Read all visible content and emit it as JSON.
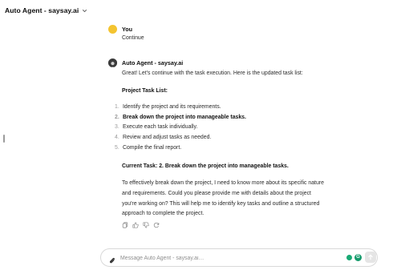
{
  "header": {
    "title": "Auto Agent - saysay.ai"
  },
  "conversation": {
    "user_message": {
      "author": "You",
      "text": "Continue"
    },
    "agent_message": {
      "author": "Auto Agent - saysay.ai",
      "intro": "Great! Let's continue with the task execution. Here is the updated task list:",
      "task_list_heading": "Project Task List:",
      "tasks": [
        {
          "num": "1.",
          "text": "Identify the project and its requirements."
        },
        {
          "num": "2.",
          "text": "Break down the project into manageable tasks."
        },
        {
          "num": "3.",
          "text": "Execute each task individually."
        },
        {
          "num": "4.",
          "text": "Review and adjust tasks as needed."
        },
        {
          "num": "5.",
          "text": "Compile the final report."
        }
      ],
      "current_task": "Current Task: 2. Break down the project into manageable tasks.",
      "explanation": "To effectively break down the project, I need to know more about its specific nature and requirements. Could you please provide me with details about the project you're working on? This will help me to identify key tasks and outline a structured approach to complete the project."
    }
  },
  "actions": [
    "copy-icon",
    "thumbs-up-icon",
    "thumbs-down-icon",
    "regenerate-icon"
  ],
  "composer": {
    "placeholder": "Message Auto Agent - saysay.ai…",
    "value": ""
  },
  "colors": {
    "user_avatar": "#f4c430",
    "extension_green": "#19a974",
    "send_disabled": "#e5e5e5"
  }
}
